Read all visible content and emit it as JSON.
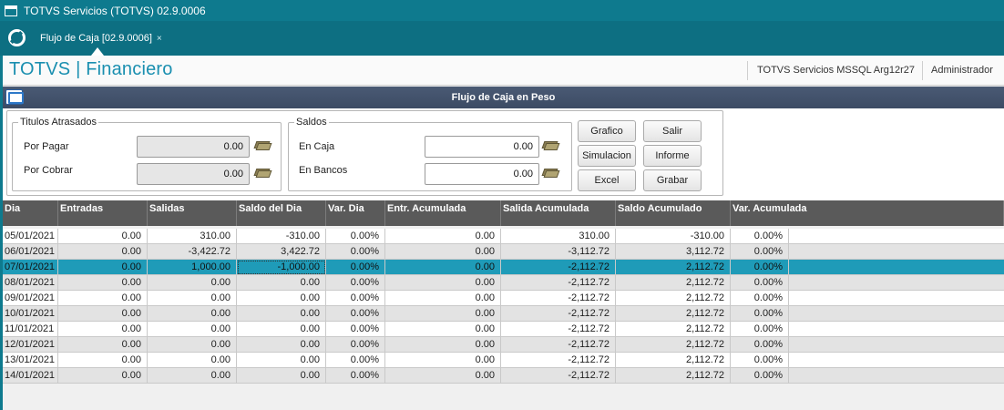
{
  "window": {
    "title": "TOTVS Servicios (TOTVS) 02.9.0006"
  },
  "tab": {
    "label": "Flujo de Caja [02.9.0006]",
    "close": "×"
  },
  "header": {
    "brand": "TOTVS | Financiero",
    "environment": "TOTVS Servicios MSSQL Arg12r27",
    "user": "Administrador"
  },
  "dialog": {
    "title": "Flujo de Caja en  Peso"
  },
  "atrasados": {
    "legend": "Titulos Atrasados",
    "pagar_label": "Por Pagar",
    "pagar_value": "0.00",
    "cobrar_label": "Por Cobrar",
    "cobrar_value": "0.00"
  },
  "saldos": {
    "legend": "Saldos",
    "caja_label": "En Caja",
    "caja_value": "0.00",
    "bancos_label": "En Bancos",
    "bancos_value": "0.00"
  },
  "buttons": {
    "grafico": "Grafico",
    "salir": "Salir",
    "simulacion": "Simulacion",
    "informe": "Informe",
    "excel": "Excel",
    "grabar": "Grabar"
  },
  "icons": {
    "money": "money-bills-icon",
    "app": "totvs-logo-icon",
    "window": "window-icon",
    "dialog": "dialog-window-icon"
  },
  "colors": {
    "titlebar": "#0e7a8e",
    "selected_row": "#1f9bb8",
    "grid_header": "#5a5a5a",
    "brand": "#1a8fb0"
  },
  "table": {
    "columns": [
      "Dia",
      "Entradas",
      "Salidas",
      "Saldo del Dia",
      "Var. Dia",
      "Entr. Acumulada",
      "Salida Acumulada",
      "Saldo Acumulado",
      "Var. Acumulada"
    ],
    "rows": [
      [
        "05/01/2021",
        "0.00",
        "310.00",
        "-310.00",
        "0.00%",
        "0.00",
        "310.00",
        "-310.00",
        "0.00%"
      ],
      [
        "06/01/2021",
        "0.00",
        "-3,422.72",
        "3,422.72",
        "0.00%",
        "0.00",
        "-3,112.72",
        "3,112.72",
        "0.00%"
      ],
      [
        "07/01/2021",
        "0.00",
        "1,000.00",
        "-1,000.00",
        "0.00%",
        "0.00",
        "-2,112.72",
        "2,112.72",
        "0.00%"
      ],
      [
        "08/01/2021",
        "0.00",
        "0.00",
        "0.00",
        "0.00%",
        "0.00",
        "-2,112.72",
        "2,112.72",
        "0.00%"
      ],
      [
        "09/01/2021",
        "0.00",
        "0.00",
        "0.00",
        "0.00%",
        "0.00",
        "-2,112.72",
        "2,112.72",
        "0.00%"
      ],
      [
        "10/01/2021",
        "0.00",
        "0.00",
        "0.00",
        "0.00%",
        "0.00",
        "-2,112.72",
        "2,112.72",
        "0.00%"
      ],
      [
        "11/01/2021",
        "0.00",
        "0.00",
        "0.00",
        "0.00%",
        "0.00",
        "-2,112.72",
        "2,112.72",
        "0.00%"
      ],
      [
        "12/01/2021",
        "0.00",
        "0.00",
        "0.00",
        "0.00%",
        "0.00",
        "-2,112.72",
        "2,112.72",
        "0.00%"
      ],
      [
        "13/01/2021",
        "0.00",
        "0.00",
        "0.00",
        "0.00%",
        "0.00",
        "-2,112.72",
        "2,112.72",
        "0.00%"
      ],
      [
        "14/01/2021",
        "0.00",
        "0.00",
        "0.00",
        "0.00%",
        "0.00",
        "-2,112.72",
        "2,112.72",
        "0.00%"
      ]
    ],
    "selected_row": 2
  }
}
